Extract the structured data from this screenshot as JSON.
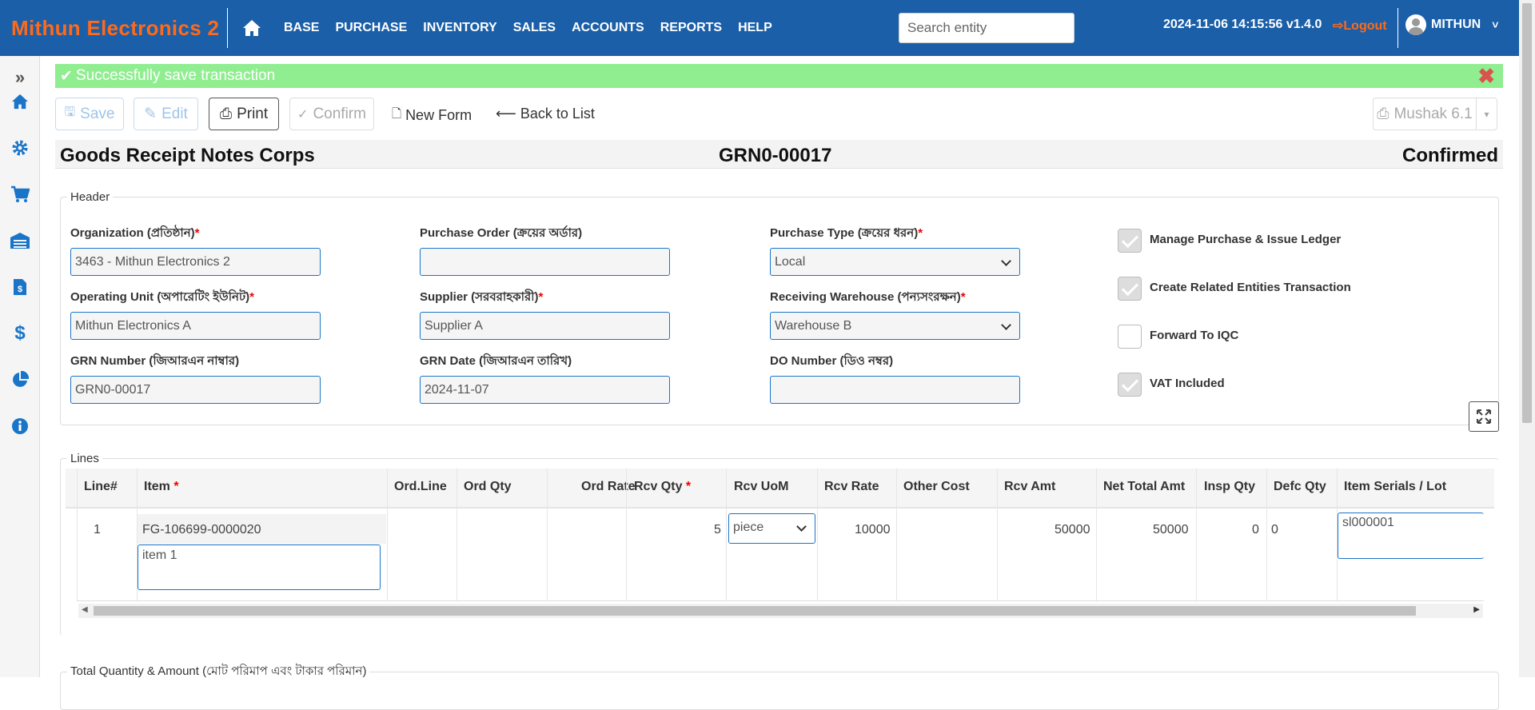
{
  "app": {
    "brand": "Mithun Electronics 2",
    "menu": [
      "BASE",
      "PURCHASE",
      "INVENTORY",
      "SALES",
      "ACCOUNTS",
      "REPORTS",
      "HELP"
    ],
    "search_placeholder": "Search entity",
    "datetime": "2024-11-06 14:15:56 v1.4.0",
    "logout": "Logout",
    "user": "MITHUN"
  },
  "alert": {
    "message": "Successfully save transaction"
  },
  "toolbar": {
    "save": "Save",
    "edit": "Edit",
    "print": "Print",
    "confirm": "Confirm",
    "new_form": "New Form",
    "back": "Back to List",
    "mushak": "Mushak 6.1"
  },
  "title": {
    "name": "Goods Receipt Notes Corps",
    "doc_no": "GRN0-00017",
    "status": "Confirmed"
  },
  "header": {
    "legend": "Header",
    "organization": {
      "label": "Organization (প্রতিষ্ঠান)",
      "value": "3463 - Mithun Electronics 2"
    },
    "purchase_order": {
      "label": "Purchase Order (ক্রয়ের অর্ডার)",
      "value": ""
    },
    "purchase_type": {
      "label": "Purchase Type (ক্রয়ের ধরন)",
      "value": "Local"
    },
    "operating_unit": {
      "label": "Operating Unit (অপারেটিং ইউনিট)",
      "value": "Mithun Electronics A"
    },
    "supplier": {
      "label": "Supplier (সরবরাহকারী)",
      "value": "Supplier A"
    },
    "warehouse": {
      "label": "Receiving Warehouse (পন্যসংরক্ষন)",
      "value": "Warehouse B"
    },
    "grn_number": {
      "label": "GRN Number (জিআরএন নাম্বার)",
      "value": "GRN0-00017"
    },
    "grn_date": {
      "label": "GRN Date (জিআরএন তারিখ)",
      "value": "2024-11-07"
    },
    "do_number": {
      "label": "DO Number (ডিও নম্বর)",
      "value": ""
    },
    "checks": [
      {
        "label": "Manage Purchase & Issue Ledger",
        "checked": true
      },
      {
        "label": "Create Related Entities Transaction",
        "checked": true
      },
      {
        "label": "Forward To IQC",
        "checked": false
      },
      {
        "label": "VAT Included",
        "checked": true
      }
    ]
  },
  "lines": {
    "legend": "Lines",
    "columns": [
      "Line#",
      "Item",
      "Ord.Line",
      "Ord Qty",
      "Ord Rate",
      "Rcv Qty",
      "Rcv UoM",
      "Rcv Rate",
      "Other Cost",
      "Rcv Amt",
      "Net Total Amt",
      "Insp Qty",
      "Defc Qty",
      "Item Serials / Lot"
    ],
    "row": {
      "line": "1",
      "item_code": "FG-106699-0000020",
      "item_desc": "item 1",
      "rcv_qty": "5",
      "uom": "piece",
      "rcv_rate": "10000",
      "rcv_amt": "50000",
      "net_total": "50000",
      "insp_qty": "0",
      "defc_qty": "0",
      "serials": "sl000001"
    }
  },
  "totals": {
    "legend": "Total Quantity & Amount (মোট পরিমাপ এবং টাকার পরিমান)"
  }
}
